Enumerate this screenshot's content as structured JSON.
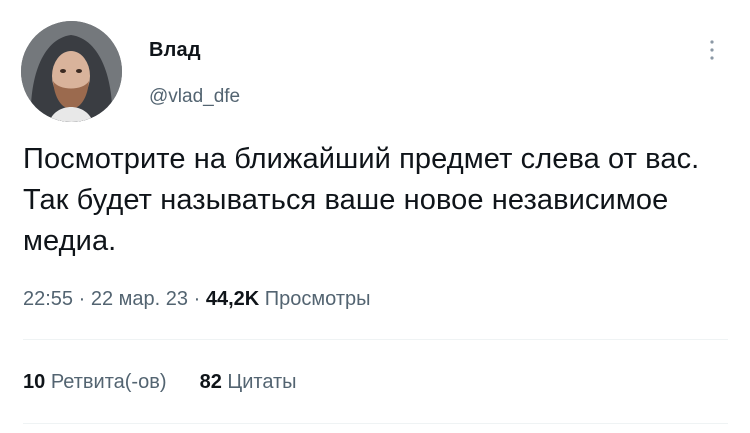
{
  "author": {
    "display_name": "Влад",
    "handle": "@vlad_dfe"
  },
  "tweet": {
    "text": "Посмотрите на ближайший предмет слева от вас. Так будет называться ваше новое независимое медиа."
  },
  "meta": {
    "time": "22:55",
    "separator": "·",
    "date": "22 мар. 23",
    "views_count": "44,2K",
    "views_label": "Просмотры"
  },
  "stats": {
    "retweets_count": "10",
    "retweets_label": "Ретвита(-ов)",
    "quotes_count": "82",
    "quotes_label": "Цитаты"
  },
  "icons": {
    "more": "more-vertical-icon"
  },
  "colors": {
    "text_primary": "#0f1419",
    "text_secondary": "#536471",
    "divider": "#eff3f4"
  }
}
